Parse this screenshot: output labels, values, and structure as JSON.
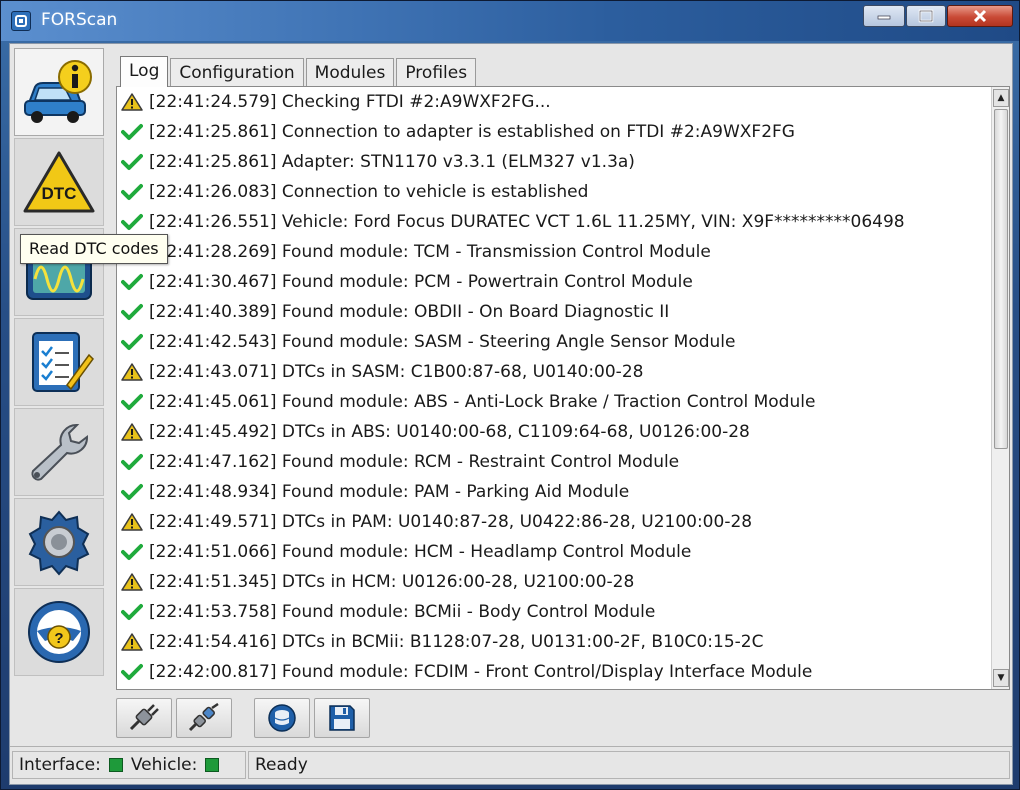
{
  "window": {
    "title": "FORScan"
  },
  "sidebar": {
    "tooltip": "Read DTC codes",
    "items": [
      {
        "name": "vehicle-info",
        "icon": "car-info-icon"
      },
      {
        "name": "dtc",
        "icon": "dtc-warning-icon",
        "label": "DTC"
      },
      {
        "name": "oscilloscope",
        "icon": "oscilloscope-icon"
      },
      {
        "name": "tests",
        "icon": "checklist-icon"
      },
      {
        "name": "service",
        "icon": "wrench-icon"
      },
      {
        "name": "configuration",
        "icon": "gear-icon"
      },
      {
        "name": "help",
        "icon": "steering-wheel-help-icon"
      }
    ]
  },
  "tabs": [
    {
      "label": "Log",
      "active": true
    },
    {
      "label": "Configuration",
      "active": false
    },
    {
      "label": "Modules",
      "active": false
    },
    {
      "label": "Profiles",
      "active": false
    }
  ],
  "log": [
    {
      "type": "warning",
      "text": "[22:41:24.579] Checking FTDI #2:A9WXF2FG..."
    },
    {
      "type": "ok",
      "text": "[22:41:25.861] Connection to adapter is established on FTDI #2:A9WXF2FG"
    },
    {
      "type": "ok",
      "text": "[22:41:25.861] Adapter:  STN1170 v3.3.1 (ELM327 v1.3a)"
    },
    {
      "type": "ok",
      "text": "[22:41:26.083] Connection to vehicle is established"
    },
    {
      "type": "ok",
      "text": "[22:41:26.551] Vehicle: Ford Focus DURATEC VCT 1.6L 11.25MY, VIN: X9F*********06498"
    },
    {
      "type": "ok",
      "text": "[22:41:28.269] Found module:  TCM - Transmission Control Module"
    },
    {
      "type": "ok",
      "text": "[22:41:30.467] Found module:  PCM - Powertrain Control Module"
    },
    {
      "type": "ok",
      "text": "[22:41:40.389] Found module:  OBDII - On Board Diagnostic II"
    },
    {
      "type": "ok",
      "text": "[22:41:42.543] Found module:  SASM - Steering Angle Sensor Module"
    },
    {
      "type": "warning",
      "text": "[22:41:43.071] DTCs in SASM: C1B00:87-68, U0140:00-28"
    },
    {
      "type": "ok",
      "text": "[22:41:45.061] Found module:  ABS - Anti-Lock Brake / Traction Control Module"
    },
    {
      "type": "warning",
      "text": "[22:41:45.492] DTCs in ABS: U0140:00-68, C1109:64-68, U0126:00-28"
    },
    {
      "type": "ok",
      "text": "[22:41:47.162] Found module:  RCM - Restraint Control Module"
    },
    {
      "type": "ok",
      "text": "[22:41:48.934] Found module:  PAM - Parking Aid Module"
    },
    {
      "type": "warning",
      "text": "[22:41:49.571] DTCs in PAM: U0140:87-28, U0422:86-28, U2100:00-28"
    },
    {
      "type": "ok",
      "text": "[22:41:51.066] Found module:  HCM - Headlamp Control Module"
    },
    {
      "type": "warning",
      "text": "[22:41:51.345] DTCs in HCM: U0126:00-28, U2100:00-28"
    },
    {
      "type": "ok",
      "text": "[22:41:53.758] Found module:  BCMii - Body Control Module"
    },
    {
      "type": "warning",
      "text": "[22:41:54.416] DTCs in BCMii: B1128:07-28, U0131:00-2F, B10C0:15-2C"
    },
    {
      "type": "ok",
      "text": "[22:42:00.817] Found module:  FCDIM - Front Control/Display Interface Module"
    }
  ],
  "toolbar": [
    {
      "name": "connect-button",
      "icon": "plug-connect-icon"
    },
    {
      "name": "disconnect-button",
      "icon": "plug-disconnect-icon"
    },
    {
      "name": "clear-log-button",
      "icon": "database-icon"
    },
    {
      "name": "save-log-button",
      "icon": "floppy-disk-icon"
    }
  ],
  "status": {
    "interface_label": "Interface:",
    "vehicle_label": "Vehicle:",
    "message": "Ready",
    "led_color": "#1e9a3a"
  },
  "colors": {
    "ok": "#1faa3c",
    "warning": "#e8c21a"
  }
}
